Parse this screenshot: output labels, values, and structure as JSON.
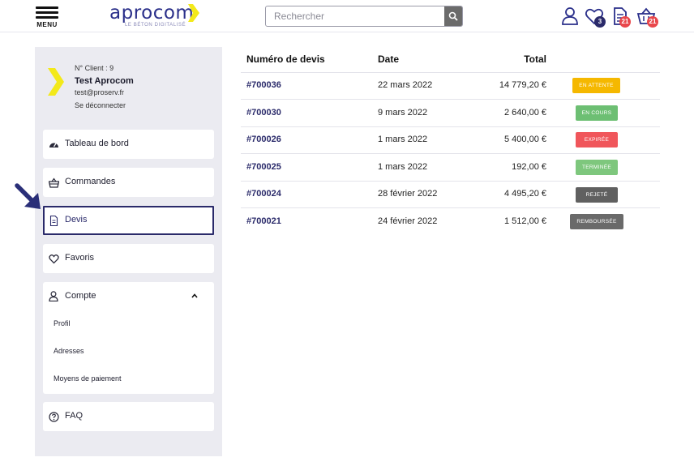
{
  "header": {
    "menu_label": "MENU",
    "logo_text": "aprocom",
    "logo_tagline": "LE BÉTON DIGITALISÉ",
    "search_placeholder": "Rechercher",
    "favorites_count": "3",
    "quotes_count": "21",
    "cart_count": "21",
    "icons": [
      "menu-icon",
      "search-icon",
      "user-icon",
      "heart-icon",
      "document-icon",
      "basket-icon"
    ]
  },
  "profile": {
    "client_number": "N° Client : 9",
    "name": "Test Aprocom",
    "email": "test@proserv.fr",
    "logout_label": "Se déconnecter"
  },
  "sidebar": {
    "items": [
      {
        "label": "Tableau de bord",
        "icon": "dashboard-icon"
      },
      {
        "label": "Commandes",
        "icon": "basket-icon"
      },
      {
        "label": "Devis",
        "icon": "document-icon"
      },
      {
        "label": "Favoris",
        "icon": "heart-icon"
      }
    ],
    "compte": {
      "label": "Compte",
      "sub_items": [
        "Profil",
        "Adresses",
        "Moyens de paiement"
      ]
    },
    "faq_label": "FAQ"
  },
  "table": {
    "headers": [
      "Numéro de devis",
      "Date",
      "Total"
    ],
    "rows": [
      {
        "number": "#700036",
        "date": "22 mars 2022",
        "total": "14 779,20 €",
        "status": "EN ATTENTE",
        "status_color": "#f5b800"
      },
      {
        "number": "#700030",
        "date": "9 mars 2022",
        "total": "2 640,00 €",
        "status": "EN COURS",
        "status_color": "#6dbf73"
      },
      {
        "number": "#700026",
        "date": "1 mars 2022",
        "total": "5 400,00 €",
        "status": "EXPIRÉE",
        "status_color": "#f0565b"
      },
      {
        "number": "#700025",
        "date": "1 mars 2022",
        "total": "192,00 €",
        "status": "TERMINÉE",
        "status_color": "#7ec77d"
      },
      {
        "number": "#700024",
        "date": "28 février 2022",
        "total": "4 495,20 €",
        "status": "REJETÉ",
        "status_color": "#606060"
      },
      {
        "number": "#700021",
        "date": "24 février 2022",
        "total": "1 512,00 €",
        "status": "REMBOURSÉE",
        "status_color": "#6a6a6a"
      }
    ]
  },
  "colors": {
    "brand_navy": "#2a2f8a",
    "brand_yellow": "#f3e91a",
    "badge_dark": "#2a2a6a",
    "badge_red": "#e9474b",
    "sidebar_bg": "#ebebf1"
  }
}
